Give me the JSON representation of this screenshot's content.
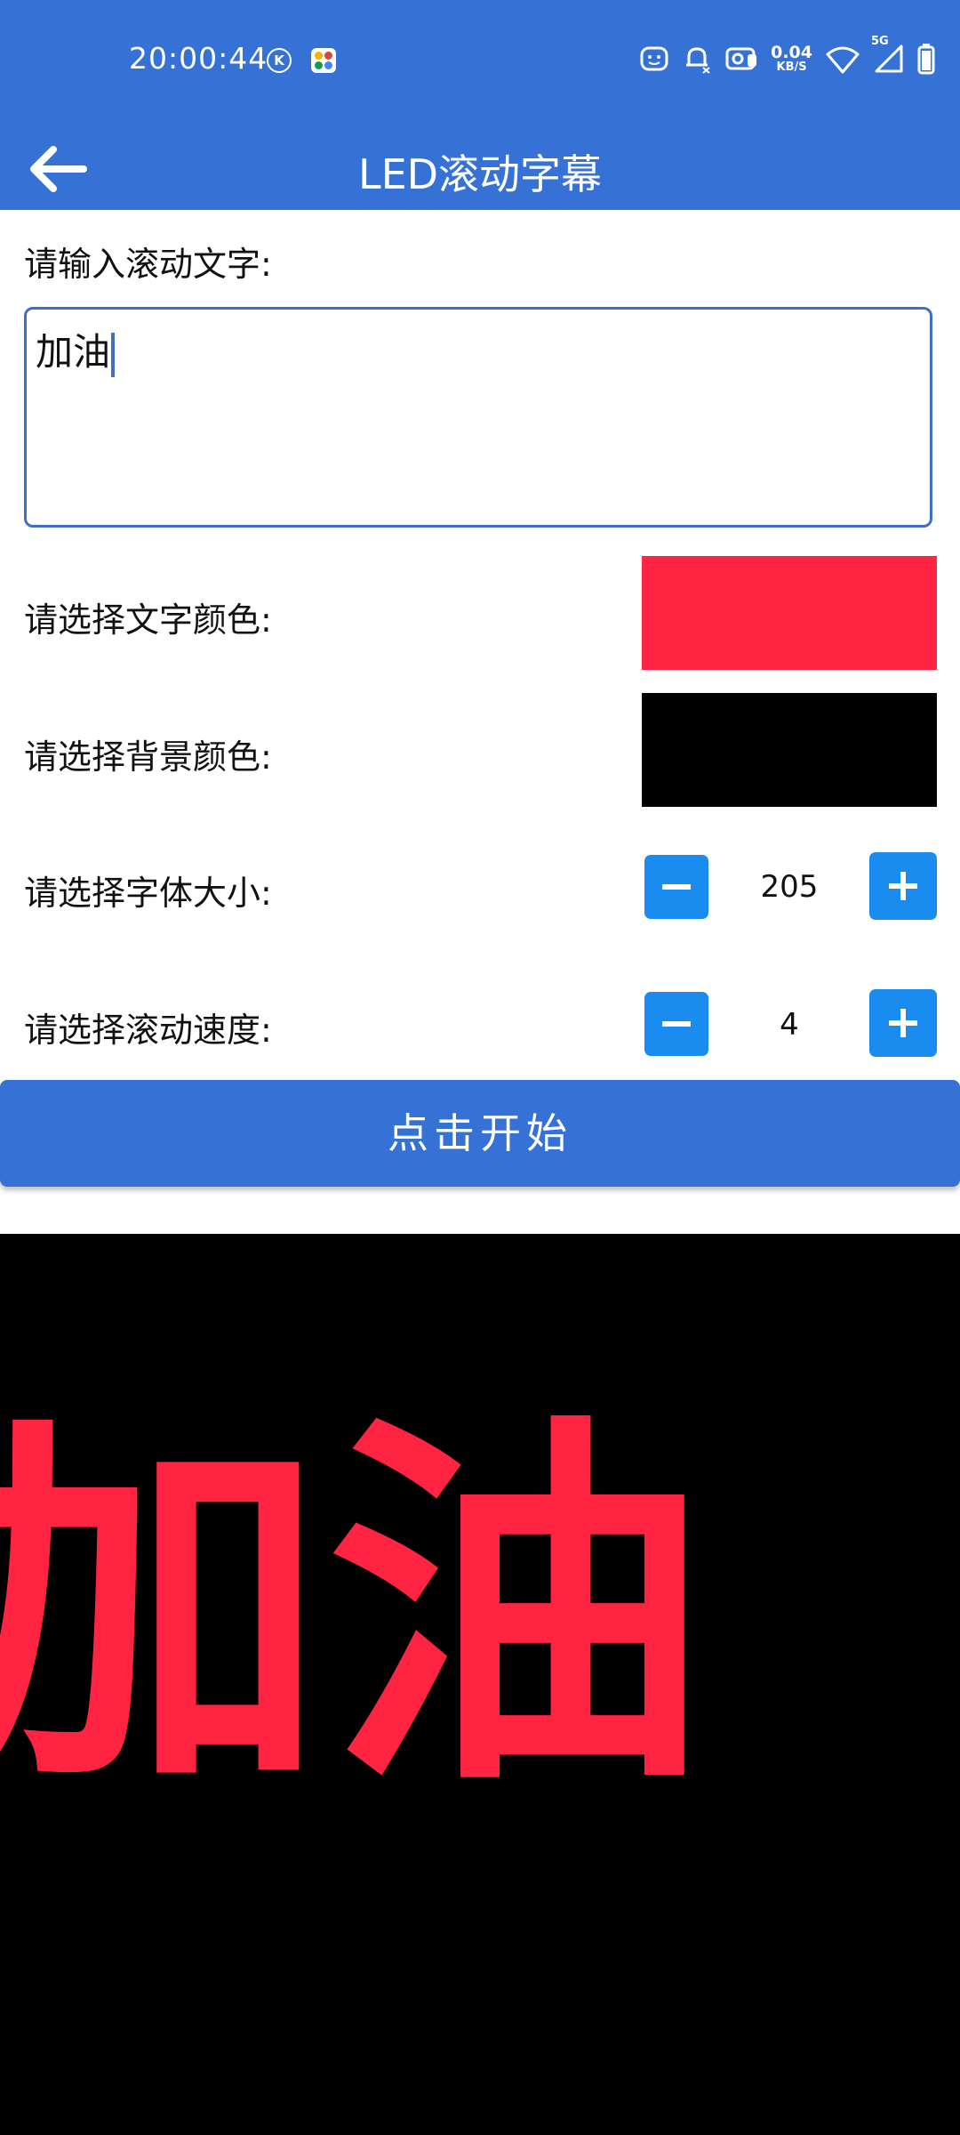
{
  "status_bar": {
    "time": "20:00:44",
    "net_speed_value": "0.04",
    "net_speed_unit": "KB/S",
    "network_badge": "5G",
    "icons": [
      "k-icon",
      "app-icon",
      "face-icon",
      "bell-muted-icon",
      "sim-icon",
      "wifi-icon",
      "signal-icon",
      "battery-icon"
    ]
  },
  "app_bar": {
    "title": "LED滚动字幕",
    "back_icon": "arrow-left-icon"
  },
  "form": {
    "text_label": "请输入滚动文字:",
    "text_value": "加油",
    "text_color_label": "请选择文字颜色:",
    "text_color": "#ff2442",
    "bg_color_label": "请选择背景颜色:",
    "bg_color": "#000000",
    "font_size_label": "请选择字体大小:",
    "font_size_value": "205",
    "speed_label": "请选择滚动速度:",
    "speed_value": "4",
    "start_button": "点击开始"
  },
  "preview": {
    "text": "加油",
    "text_color": "#ff2442",
    "bg_color": "#000000"
  },
  "colors": {
    "primary": "#3672d6",
    "stepper": "#1a8cf0"
  }
}
